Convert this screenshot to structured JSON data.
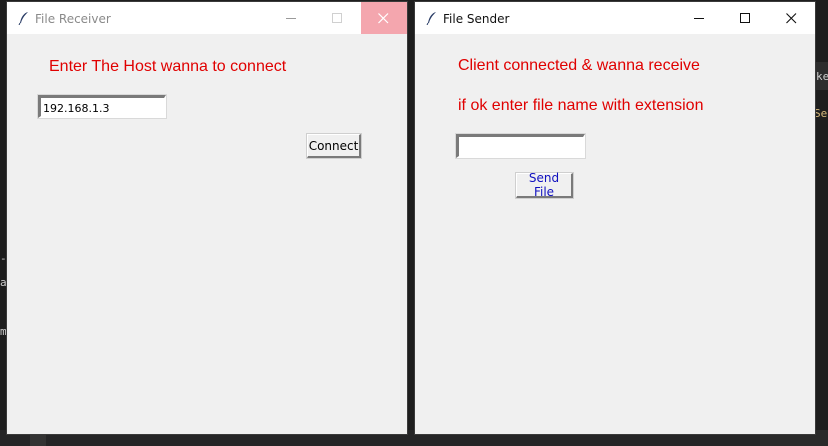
{
  "background": {
    "fragments": [
      "ke",
      "Ser",
      "-",
      "as",
      "m"
    ]
  },
  "receiver": {
    "title": "File Receiver",
    "prompt": "Enter The Host wanna to connect",
    "host_value": "192.168.1.3",
    "connect_label": "Connect"
  },
  "sender": {
    "title": "File Sender",
    "line1": "Client connected & wanna receive",
    "line2": "if ok enter file name with extension",
    "filename_value": "",
    "send_label": "Send File"
  },
  "colors": {
    "label_red": "#e00000",
    "send_button_text": "#1010c0",
    "close_hover": "#f4a6ae"
  }
}
